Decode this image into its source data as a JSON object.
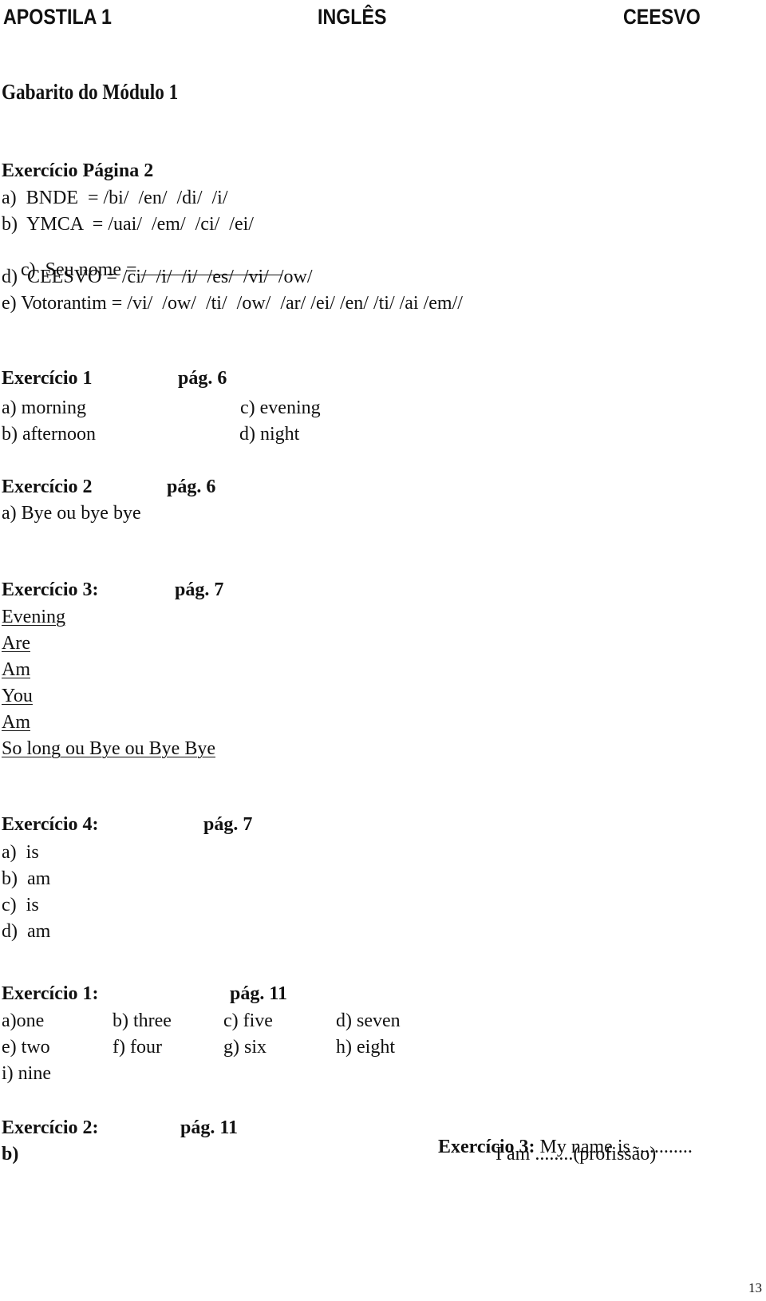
{
  "header": {
    "left": "APOSTILA 1",
    "center": "INGLÊS",
    "right": "CEESVO"
  },
  "title": "Gabarito do Módulo 1",
  "ex_pagina2": {
    "heading": "Exercício Página 2",
    "items": [
      "a)  BNDE  = /bi/  /en/  /di/  /i/",
      "b)  YMCA  = /uai/  /em/  /ci/  /ei/",
      "c)  Seu nome =",
      "d)  CEESVO = /ci/  /i/  /i/  /es/  /vi/  /ow/",
      "e) Votorantim = /vi/  /ow/  /ti/  /ow/  /ar/ /ei/ /en/ /ti/ /ai /em//"
    ]
  },
  "ex1_p6": {
    "heading": "Exercício 1",
    "page": "pág. 6",
    "items": [
      "a) morning",
      "b) afternoon",
      "c) evening",
      "d) night"
    ]
  },
  "ex2_p6": {
    "heading": "Exercício 2",
    "page": "pág. 6",
    "items": [
      "a) Bye ou bye bye"
    ]
  },
  "ex3_p7": {
    "heading": "Exercício 3:",
    "page": "pág. 7",
    "items": [
      "Evening",
      "Are",
      "Am",
      "You",
      "Am",
      "So long ou Bye ou Bye Bye"
    ]
  },
  "ex4_p7": {
    "heading": "Exercício 4:",
    "page": "pág. 7",
    "items": [
      "a)  is",
      "b)  am",
      "c)  is",
      "d)  am"
    ]
  },
  "ex1_p11": {
    "heading": "Exercício 1:",
    "page": "pág. 11",
    "items": [
      "a)one",
      "b) three",
      "c) five",
      "d) seven",
      "e) two",
      "f) four",
      "g) six",
      "h) eight",
      "i) nine"
    ]
  },
  "ex2_p11": {
    "heading": "Exercício 2:",
    "page": "pág. 11",
    "items": [
      "b)"
    ]
  },
  "ex3_p11": {
    "heading": "Exercício 3:",
    "line1": " My name is ............",
    "line2": "I am ........(profissão)"
  },
  "page_number": "13"
}
